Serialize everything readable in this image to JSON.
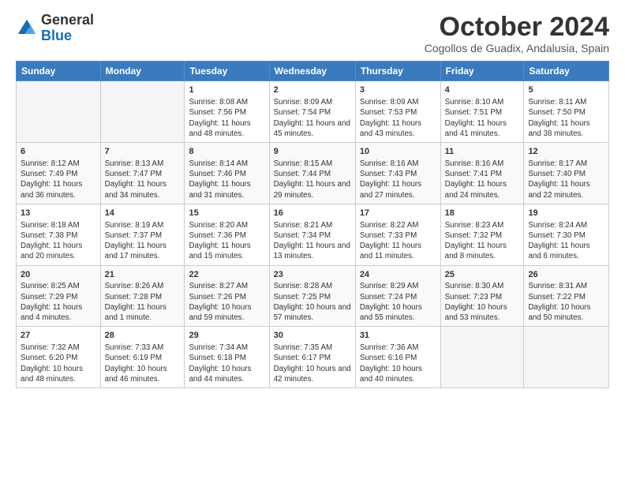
{
  "header": {
    "logo": {
      "line1": "General",
      "line2": "Blue"
    },
    "title": "October 2024",
    "location": "Cogollos de Guadix, Andalusia, Spain"
  },
  "weekdays": [
    "Sunday",
    "Monday",
    "Tuesday",
    "Wednesday",
    "Thursday",
    "Friday",
    "Saturday"
  ],
  "weeks": [
    [
      {
        "day": "",
        "info": ""
      },
      {
        "day": "",
        "info": ""
      },
      {
        "day": "1",
        "info": "Sunrise: 8:08 AM\nSunset: 7:56 PM\nDaylight: 11 hours and 48 minutes."
      },
      {
        "day": "2",
        "info": "Sunrise: 8:09 AM\nSunset: 7:54 PM\nDaylight: 11 hours and 45 minutes."
      },
      {
        "day": "3",
        "info": "Sunrise: 8:09 AM\nSunset: 7:53 PM\nDaylight: 11 hours and 43 minutes."
      },
      {
        "day": "4",
        "info": "Sunrise: 8:10 AM\nSunset: 7:51 PM\nDaylight: 11 hours and 41 minutes."
      },
      {
        "day": "5",
        "info": "Sunrise: 8:11 AM\nSunset: 7:50 PM\nDaylight: 11 hours and 38 minutes."
      }
    ],
    [
      {
        "day": "6",
        "info": "Sunrise: 8:12 AM\nSunset: 7:49 PM\nDaylight: 11 hours and 36 minutes."
      },
      {
        "day": "7",
        "info": "Sunrise: 8:13 AM\nSunset: 7:47 PM\nDaylight: 11 hours and 34 minutes."
      },
      {
        "day": "8",
        "info": "Sunrise: 8:14 AM\nSunset: 7:46 PM\nDaylight: 11 hours and 31 minutes."
      },
      {
        "day": "9",
        "info": "Sunrise: 8:15 AM\nSunset: 7:44 PM\nDaylight: 11 hours and 29 minutes."
      },
      {
        "day": "10",
        "info": "Sunrise: 8:16 AM\nSunset: 7:43 PM\nDaylight: 11 hours and 27 minutes."
      },
      {
        "day": "11",
        "info": "Sunrise: 8:16 AM\nSunset: 7:41 PM\nDaylight: 11 hours and 24 minutes."
      },
      {
        "day": "12",
        "info": "Sunrise: 8:17 AM\nSunset: 7:40 PM\nDaylight: 11 hours and 22 minutes."
      }
    ],
    [
      {
        "day": "13",
        "info": "Sunrise: 8:18 AM\nSunset: 7:38 PM\nDaylight: 11 hours and 20 minutes."
      },
      {
        "day": "14",
        "info": "Sunrise: 8:19 AM\nSunset: 7:37 PM\nDaylight: 11 hours and 17 minutes."
      },
      {
        "day": "15",
        "info": "Sunrise: 8:20 AM\nSunset: 7:36 PM\nDaylight: 11 hours and 15 minutes."
      },
      {
        "day": "16",
        "info": "Sunrise: 8:21 AM\nSunset: 7:34 PM\nDaylight: 11 hours and 13 minutes."
      },
      {
        "day": "17",
        "info": "Sunrise: 8:22 AM\nSunset: 7:33 PM\nDaylight: 11 hours and 11 minutes."
      },
      {
        "day": "18",
        "info": "Sunrise: 8:23 AM\nSunset: 7:32 PM\nDaylight: 11 hours and 8 minutes."
      },
      {
        "day": "19",
        "info": "Sunrise: 8:24 AM\nSunset: 7:30 PM\nDaylight: 11 hours and 6 minutes."
      }
    ],
    [
      {
        "day": "20",
        "info": "Sunrise: 8:25 AM\nSunset: 7:29 PM\nDaylight: 11 hours and 4 minutes."
      },
      {
        "day": "21",
        "info": "Sunrise: 8:26 AM\nSunset: 7:28 PM\nDaylight: 11 hours and 1 minute."
      },
      {
        "day": "22",
        "info": "Sunrise: 8:27 AM\nSunset: 7:26 PM\nDaylight: 10 hours and 59 minutes."
      },
      {
        "day": "23",
        "info": "Sunrise: 8:28 AM\nSunset: 7:25 PM\nDaylight: 10 hours and 57 minutes."
      },
      {
        "day": "24",
        "info": "Sunrise: 8:29 AM\nSunset: 7:24 PM\nDaylight: 10 hours and 55 minutes."
      },
      {
        "day": "25",
        "info": "Sunrise: 8:30 AM\nSunset: 7:23 PM\nDaylight: 10 hours and 53 minutes."
      },
      {
        "day": "26",
        "info": "Sunrise: 8:31 AM\nSunset: 7:22 PM\nDaylight: 10 hours and 50 minutes."
      }
    ],
    [
      {
        "day": "27",
        "info": "Sunrise: 7:32 AM\nSunset: 6:20 PM\nDaylight: 10 hours and 48 minutes."
      },
      {
        "day": "28",
        "info": "Sunrise: 7:33 AM\nSunset: 6:19 PM\nDaylight: 10 hours and 46 minutes."
      },
      {
        "day": "29",
        "info": "Sunrise: 7:34 AM\nSunset: 6:18 PM\nDaylight: 10 hours and 44 minutes."
      },
      {
        "day": "30",
        "info": "Sunrise: 7:35 AM\nSunset: 6:17 PM\nDaylight: 10 hours and 42 minutes."
      },
      {
        "day": "31",
        "info": "Sunrise: 7:36 AM\nSunset: 6:16 PM\nDaylight: 10 hours and 40 minutes."
      },
      {
        "day": "",
        "info": ""
      },
      {
        "day": "",
        "info": ""
      }
    ]
  ]
}
